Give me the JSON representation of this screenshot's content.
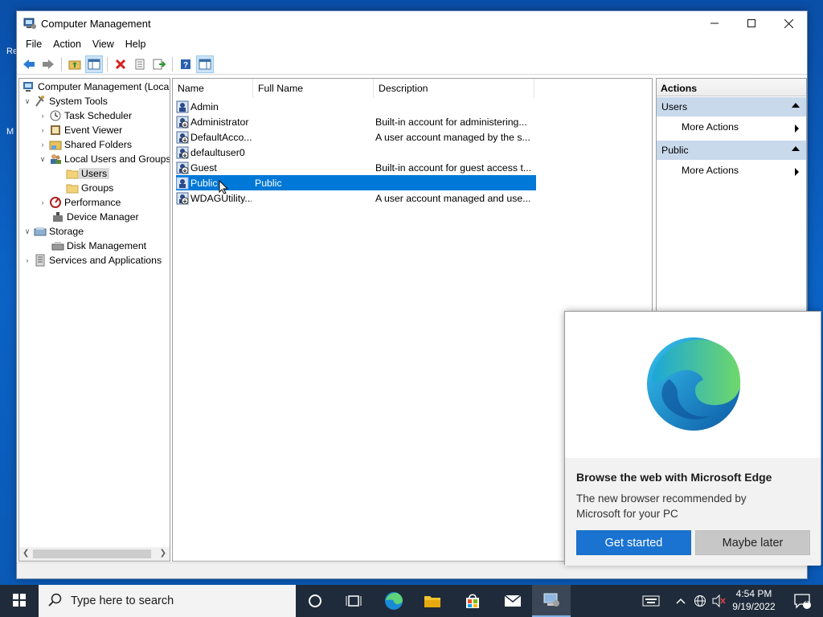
{
  "desktop": {
    "icon_label_1": "Re",
    "icon_label_2": "M"
  },
  "window": {
    "title": "Computer Management",
    "menu": [
      "File",
      "Action",
      "View",
      "Help"
    ]
  },
  "tree": {
    "items": [
      {
        "label": "Computer Management (Local",
        "icon": "computer-management-icon"
      },
      {
        "label": "System Tools",
        "icon": "system-tools-icon"
      },
      {
        "label": "Task Scheduler",
        "icon": "clock-icon"
      },
      {
        "label": "Event Viewer",
        "icon": "event-viewer-icon"
      },
      {
        "label": "Shared Folders",
        "icon": "shared-folder-icon"
      },
      {
        "label": "Local Users and Groups",
        "icon": "users-groups-icon"
      },
      {
        "label": "Users",
        "icon": "folder-icon"
      },
      {
        "label": "Groups",
        "icon": "folder-icon"
      },
      {
        "label": "Performance",
        "icon": "performance-icon"
      },
      {
        "label": "Device Manager",
        "icon": "device-manager-icon"
      },
      {
        "label": "Storage",
        "icon": "storage-icon"
      },
      {
        "label": "Disk Management",
        "icon": "disk-icon"
      },
      {
        "label": "Services and Applications",
        "icon": "services-icon"
      }
    ]
  },
  "list": {
    "columns": [
      "Name",
      "Full Name",
      "Description"
    ],
    "rows": [
      {
        "name": "Admin",
        "full_name": "",
        "description": ""
      },
      {
        "name": "Administrator",
        "full_name": "",
        "description": "Built-in account for administering..."
      },
      {
        "name": "DefaultAcco...",
        "full_name": "",
        "description": "A user account managed by the s..."
      },
      {
        "name": "defaultuser0",
        "full_name": "",
        "description": ""
      },
      {
        "name": "Guest",
        "full_name": "",
        "description": "Built-in account for guest access t..."
      },
      {
        "name": "Public",
        "full_name": "Public",
        "description": ""
      },
      {
        "name": "WDAGUtility...",
        "full_name": "",
        "description": "A user account managed and use..."
      }
    ],
    "selected": "Public"
  },
  "actions": {
    "title": "Actions",
    "sections": [
      {
        "header": "Users",
        "item": "More Actions"
      },
      {
        "header": "Public",
        "item": "More Actions"
      }
    ]
  },
  "edge_popup": {
    "heading": "Browse the web with Microsoft Edge",
    "body": "The new browser recommended by Microsoft for your PC",
    "primary": "Get started",
    "secondary": "Maybe later"
  },
  "taskbar": {
    "search_placeholder": "Type here to search",
    "time": "4:54 PM",
    "date": "9/19/2022",
    "notification_count": "1"
  },
  "colors": {
    "selection": "#0078d7",
    "accent": "#1a73d1",
    "section_header": "#c9d9ec"
  }
}
